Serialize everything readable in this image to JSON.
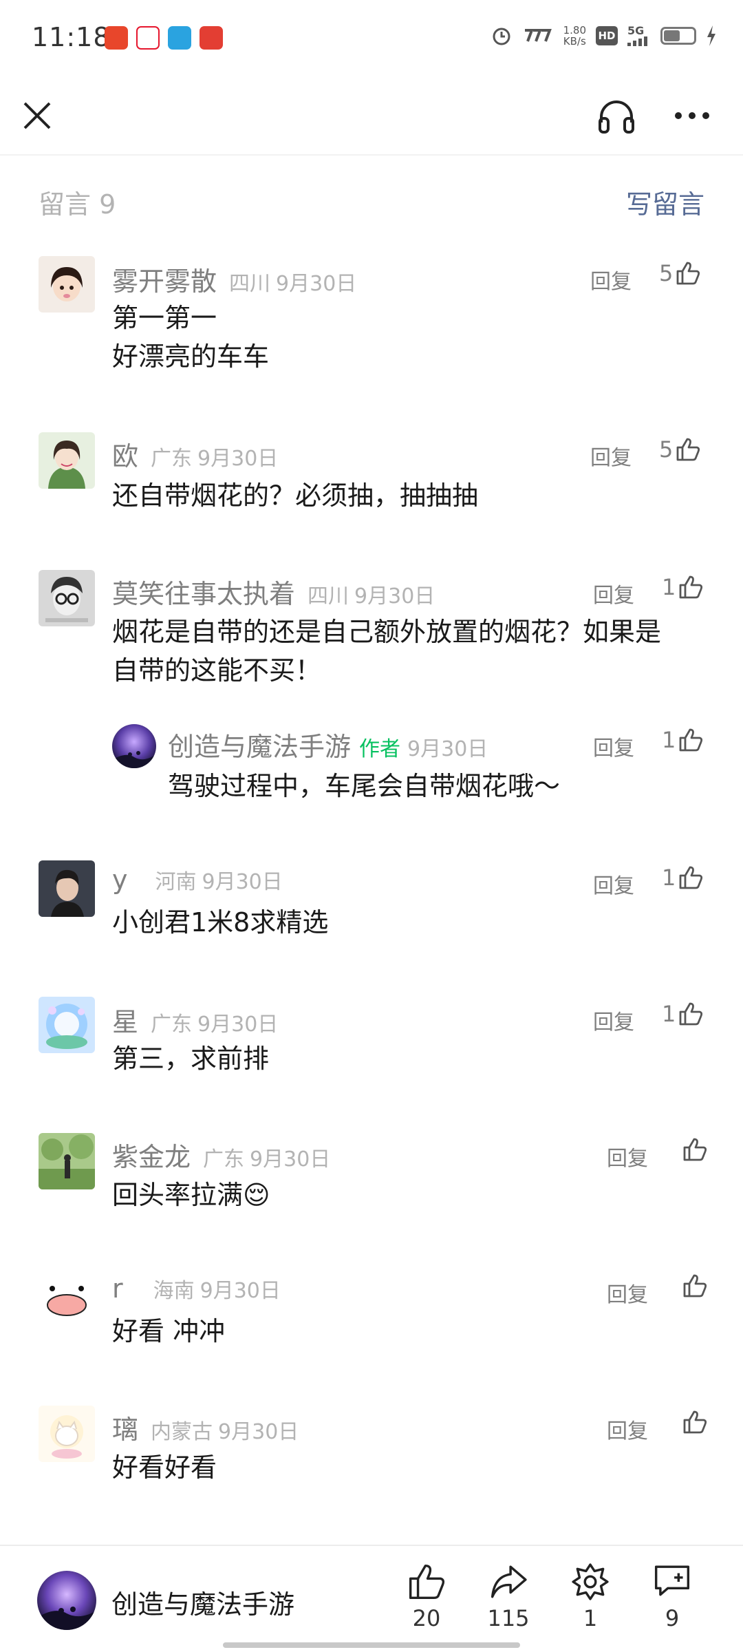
{
  "status_bar": {
    "time": "11:18",
    "net_speed_value": "1.80",
    "net_speed_unit": "KB/s",
    "hd": "HD",
    "network": "5G",
    "battery_level": 0.55
  },
  "header": {
    "comments_label": "留言 9",
    "write_label": "写留言"
  },
  "comments": [
    {
      "name": "雾开雾散",
      "location": "四川",
      "date": "9月30日",
      "text": "第一第一\n好漂亮的车车",
      "reply": "回复",
      "likes": "5"
    },
    {
      "name": "欧",
      "location": "广东",
      "date": "9月30日",
      "text": "还自带烟花的？必须抽，抽抽抽",
      "reply": "回复",
      "likes": "5"
    },
    {
      "name": "莫笑往事太执着",
      "location": "四川",
      "date": "9月30日",
      "text": "烟花是自带的还是自己额外放置的烟花？如果是\n自带的这能不买！",
      "reply": "回复",
      "likes": "1"
    },
    {
      "name": "创造与魔法手游",
      "author_tag": "作者",
      "date": "9月30日",
      "text": "驾驶过程中，车尾会自带烟花哦～",
      "reply": "回复",
      "likes": "1"
    },
    {
      "name": "y",
      "location": "河南",
      "date": "9月30日",
      "text": "小创君1米8求精选",
      "reply": "回复",
      "likes": "1"
    },
    {
      "name": "星",
      "location": "广东",
      "date": "9月30日",
      "text": "第三，求前排",
      "reply": "回复",
      "likes": "1"
    },
    {
      "name": "紫金龙",
      "location": "广东",
      "date": "9月30日",
      "text": "回头率拉满😌",
      "reply": "回复",
      "likes": ""
    },
    {
      "name": "r",
      "location": "海南",
      "date": "9月30日",
      "text": "好看 冲冲",
      "reply": "回复",
      "likes": ""
    },
    {
      "name": "璃",
      "location": "内蒙古",
      "date": "9月30日",
      "text": "好看好看",
      "reply": "回复",
      "likes": ""
    }
  ],
  "bottom_bar": {
    "account_name": "创造与魔法手游",
    "likes": "20",
    "shares": "115",
    "wow": "1",
    "comments": "9"
  },
  "colors": {
    "link": "#576b95",
    "author_tag": "#07c160",
    "meta_gray": "#b3b3b3"
  }
}
